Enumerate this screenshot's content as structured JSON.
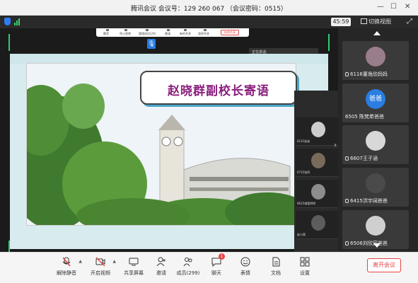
{
  "window": {
    "title": "腾讯会议 会议号：129 260 067 （会议密码：0515）"
  },
  "subbar": {
    "timer": "45:59",
    "switch_view": "切换视图"
  },
  "minitoolbar": {
    "items": [
      "静音",
      "停止视频",
      "管理成员(29)",
      "邀请",
      "新的共享",
      "暂停共享"
    ],
    "stop_label": "结束共享"
  },
  "screen": {
    "slide_title": "赵晓群副校长寄语",
    "speaking_label": "正在讲话:",
    "video_labels": [
      "6121苗苗",
      "6715张四",
      "6615诸葛明明",
      "赵小燕"
    ]
  },
  "sidebar": {
    "participants": [
      {
        "name": "6116董逸欣妈妈"
      },
      {
        "name": "6505 陈梵希爸爸",
        "avatar_text": "爸爸"
      },
      {
        "name": "6607王子涵"
      },
      {
        "name": "6415洪宇阔爸爸"
      },
      {
        "name": "6506刘欣宸爸爸"
      }
    ]
  },
  "toolbar": {
    "mute": "解除静音",
    "video": "开启视频",
    "share": "共享屏幕",
    "invite": "邀请",
    "members": "成员(299)",
    "chat": "聊天",
    "chat_badge": "1",
    "reaction": "表情",
    "docs": "文档",
    "settings": "设置",
    "leave": "离开会议"
  },
  "colors": {
    "accent": "#2a7de1",
    "danger": "#e64545",
    "title_purple": "#8a1f7e",
    "active_green": "#2ecc71"
  }
}
